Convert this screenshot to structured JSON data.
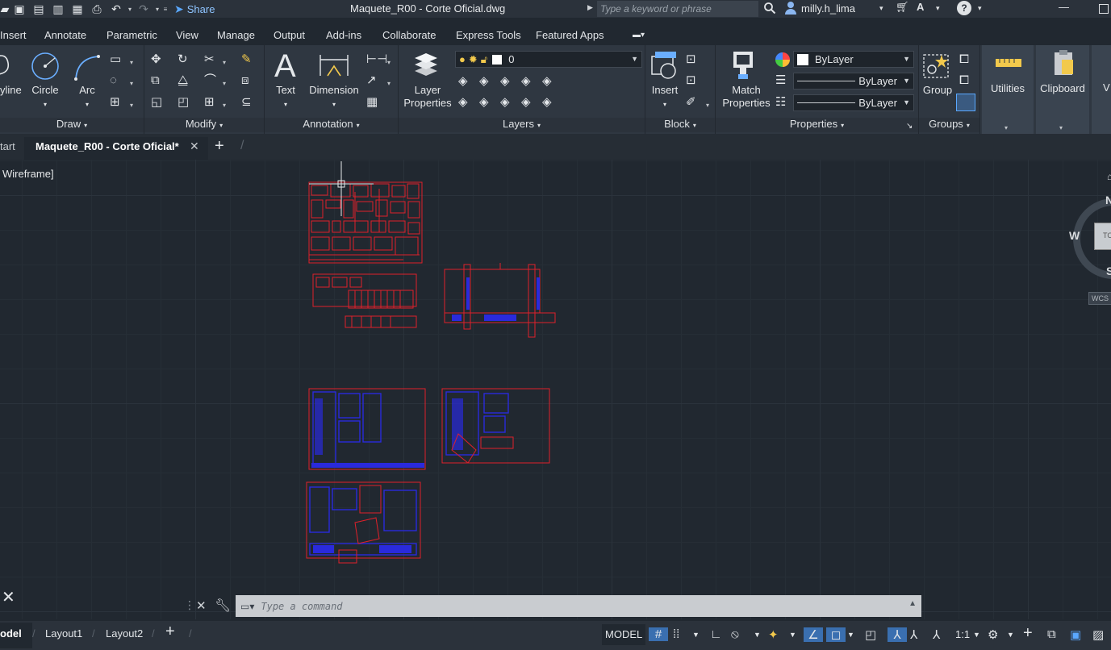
{
  "titlebar": {
    "share_label": "Share",
    "document_title": "Maquete_R00 - Corte Oficial.dwg",
    "search_placeholder": "Type a keyword or phrase",
    "username": "milly.h_lima"
  },
  "ribbon_tabs": [
    "Insert",
    "Annotate",
    "Parametric",
    "View",
    "Manage",
    "Output",
    "Add-ins",
    "Collaborate",
    "Express Tools",
    "Featured Apps"
  ],
  "panels": {
    "draw": {
      "label": "Draw",
      "polyline": "yline",
      "circle": "Circle",
      "arc": "Arc"
    },
    "modify": {
      "label": "Modify"
    },
    "annotation": {
      "label": "Annotation",
      "text": "Text",
      "dimension": "Dimension"
    },
    "layers": {
      "label": "Layers",
      "layer_properties_1": "Layer",
      "layer_properties_2": "Properties",
      "current_layer": "0"
    },
    "block": {
      "label": "Block",
      "insert": "Insert"
    },
    "properties": {
      "label": "Properties",
      "match_1": "Match",
      "match_2": "Properties",
      "color": "ByLayer",
      "linetype": "ByLayer",
      "lineweight": "ByLayer"
    },
    "groups": {
      "label": "Groups",
      "group": "Group"
    },
    "utilities": {
      "label": "Utilities"
    },
    "clipboard": {
      "label": "Clipboard"
    }
  },
  "doc_tabs": {
    "start": "tart",
    "active": "Maquete_R00 - Corte Oficial*"
  },
  "viewport": {
    "style_label": "Wireframe]",
    "viewcube": {
      "west": "W",
      "north": "N",
      "south": "S",
      "top": "TO",
      "wcs": "WCS"
    }
  },
  "command_line": {
    "placeholder": "Type a command"
  },
  "statusbar": {
    "layout_tabs": [
      "odel",
      "Layout1",
      "Layout2"
    ],
    "model_label": "MODEL",
    "scale": "1:1"
  },
  "colors": {
    "accent": "#3a6fb0",
    "drawing_red": "#e0202a",
    "drawing_blue": "#2a2adc"
  }
}
